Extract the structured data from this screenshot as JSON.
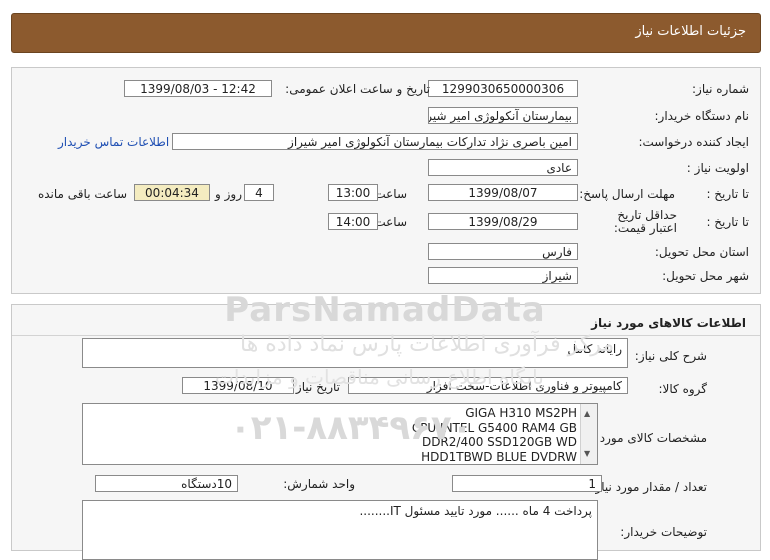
{
  "header": {
    "title": "جزئیات اطلاعات نیاز"
  },
  "info": {
    "need_number_label": "شماره نیاز:",
    "need_number": "1299030650000306",
    "announce_label": "تاریخ و ساعت اعلان عمومی:",
    "announce_value": "1399/08/03 - 12:42",
    "buyer_org_label": "نام دستگاه خریدار:",
    "buyer_org": "بیمارستان آنکولوژی امیر شیراز",
    "creator_label": "ایجاد کننده درخواست:",
    "creator": "امین باصری نژاد تدارکات بیمارستان آنکولوژی امیر شیراز",
    "contact_link": "اطلاعات تماس خریدار",
    "priority_label": "اولویت نیاز :",
    "priority": "عادی",
    "deadline_label": "مهلت ارسال پاسخ:",
    "to_date_label": "تا تاریخ :",
    "deadline_date": "1399/08/07",
    "time_label": "ساعت",
    "deadline_time": "13:00",
    "days_value": "4",
    "days_label": "روز و",
    "remaining_value": "00:04:34",
    "remaining_label": "ساعت باقی مانده",
    "validity_label": "حداقل تاریخ اعتبار قیمت:",
    "validity_date": "1399/08/29",
    "validity_time": "14:00",
    "province_label": "استان محل تحویل:",
    "province": "فارس",
    "city_label": "شهر محل تحویل:",
    "city": "شیراز"
  },
  "goods": {
    "section_title": "اطلاعات کالاهای مورد نیاز",
    "summary_label": "شرح کلی نیاز:",
    "summary": "رایانه کامل",
    "group_label": "گروه کالا:",
    "group": "کامپیوتر و فناوری اطلاعات-سخت افزار",
    "need_date_label": "تاریخ نیاز به کالا:",
    "need_date": "1399/08/10",
    "specs_label": "مشخصات کالای مورد نیاز:",
    "specs_lines": [
      "GIGA H310 MS2PH",
      "CPU INTEL G5400 RAM4 GB",
      "DDR2/400 SSD120GB  WD",
      "HDD1TBWD BLUE DVDRW"
    ],
    "qty_label": "تعداد / مقدار مورد نیاز:",
    "qty": "1",
    "unit_label": "واحد شمارش:",
    "unit": "10دستگاه",
    "buyer_notes_label": "توضیحات خریدار:",
    "buyer_notes": "پرداخت 4 ماه ...... مورد تایید مسئول IT........"
  },
  "watermark": {
    "line1": "ParsNamadData",
    "line2": "مرکز فرآوری اطلاعات پارس نماد داده ها",
    "line3": "پایگاه اطلاع رسانی مناقصات و مزایدات",
    "line4": "۰۲۱-۸۸۳۴۹۶۷۰"
  }
}
